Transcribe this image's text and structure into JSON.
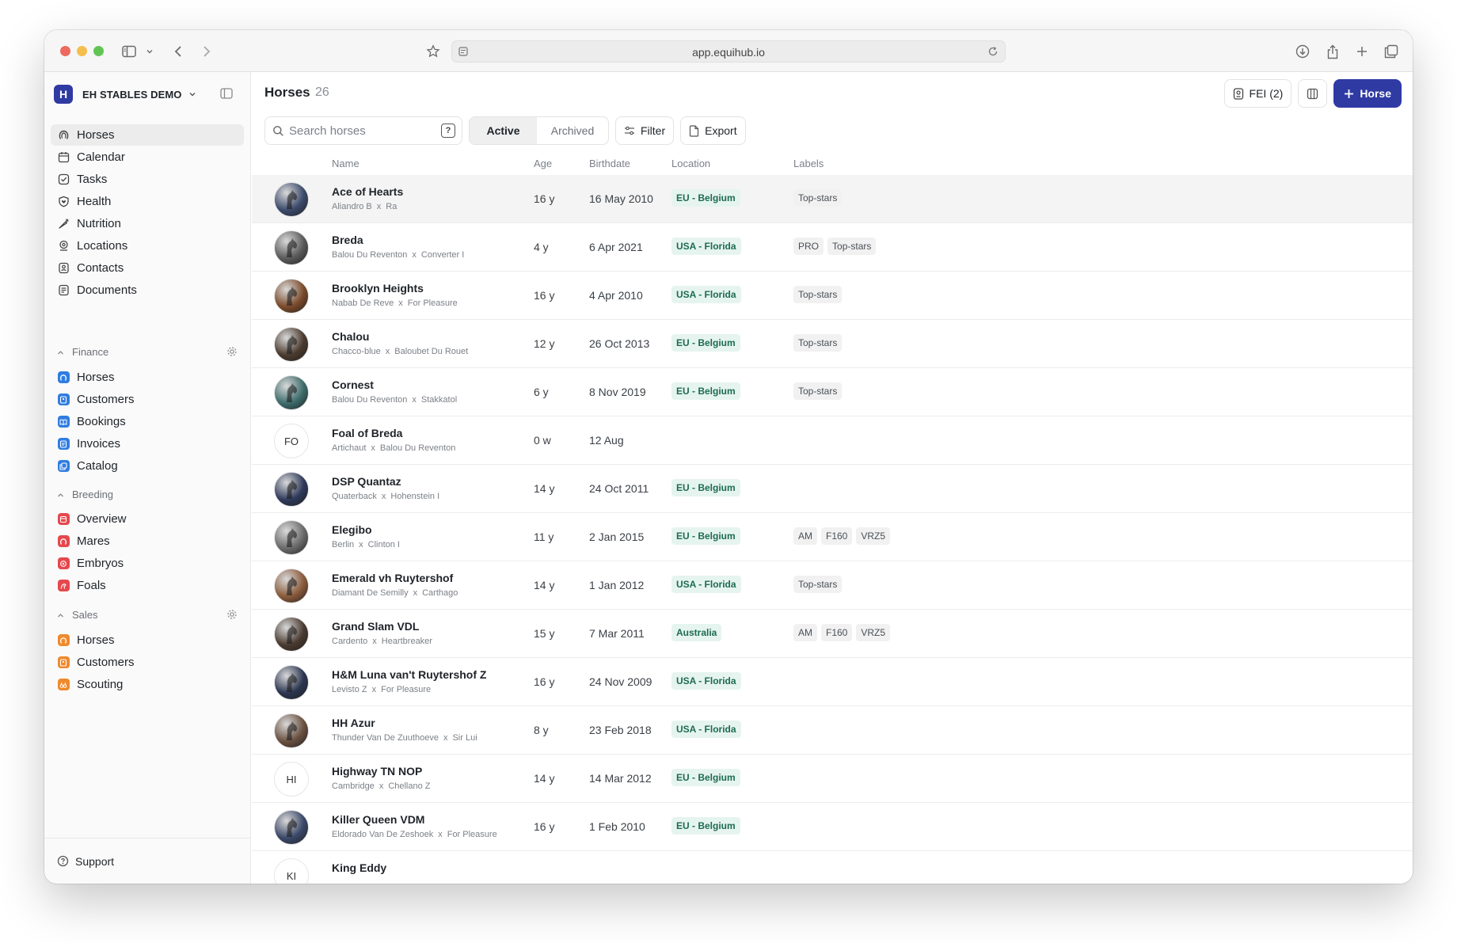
{
  "browser": {
    "url": "app.equihub.io"
  },
  "sidebar": {
    "workspace_initial": "H",
    "workspace_name": "EH STABLES DEMO",
    "main_items": [
      {
        "label": "Horses",
        "icon": "horseshoe-icon",
        "active": true
      },
      {
        "label": "Calendar",
        "icon": "calendar-icon"
      },
      {
        "label": "Tasks",
        "icon": "check-square-icon"
      },
      {
        "label": "Health",
        "icon": "heart-shield-icon"
      },
      {
        "label": "Nutrition",
        "icon": "carrot-icon"
      },
      {
        "label": "Locations",
        "icon": "map-pin-icon"
      },
      {
        "label": "Contacts",
        "icon": "contact-icon"
      },
      {
        "label": "Documents",
        "icon": "document-icon"
      }
    ],
    "sections": [
      {
        "title": "Finance",
        "color": "#2f7de1",
        "items": [
          "Horses",
          "Customers",
          "Bookings",
          "Invoices",
          "Catalog"
        ]
      },
      {
        "title": "Breeding",
        "color": "#e5484d",
        "items": [
          "Overview",
          "Mares",
          "Embryos",
          "Foals"
        ]
      },
      {
        "title": "Sales",
        "color": "#f0892b",
        "items": [
          "Horses",
          "Customers",
          "Scouting"
        ]
      }
    ],
    "support_label": "Support"
  },
  "header": {
    "title": "Horses",
    "count": "26",
    "fei_label": "FEI (2)",
    "add_label": "Horse"
  },
  "toolbar": {
    "search_placeholder": "Search horses",
    "help_glyph": "?",
    "tab_active": "Active",
    "tab_archived": "Archived",
    "filter_label": "Filter",
    "export_label": "Export"
  },
  "table": {
    "columns": {
      "name": "Name",
      "age": "Age",
      "birthdate": "Birthdate",
      "location": "Location",
      "labels": "Labels"
    },
    "rows": [
      {
        "name": "Ace of Hearts",
        "sire": "Aliandro B",
        "dam": "Ra",
        "age": "16 y",
        "birthdate": "16 May 2010",
        "location": "EU - Belgium",
        "labels": [
          "Top-stars"
        ],
        "avatar": "photo",
        "tone": "#3b4a6b"
      },
      {
        "name": "Breda",
        "sire": "Balou Du Reventon",
        "dam": "Converter I",
        "age": "4 y",
        "birthdate": "6 Apr 2021",
        "location": "USA - Florida",
        "labels": [
          "PRO",
          "Top-stars"
        ],
        "avatar": "photo",
        "tone": "#5a5a5a"
      },
      {
        "name": "Brooklyn Heights",
        "sire": "Nabab De Reve",
        "dam": "For Pleasure",
        "age": "16 y",
        "birthdate": "4 Apr 2010",
        "location": "USA - Florida",
        "labels": [
          "Top-stars"
        ],
        "avatar": "photo",
        "tone": "#7a4a2a"
      },
      {
        "name": "Chalou",
        "sire": "Chacco-blue",
        "dam": "Baloubet Du Rouet",
        "age": "12 y",
        "birthdate": "26 Oct 2013",
        "location": "EU - Belgium",
        "labels": [
          "Top-stars"
        ],
        "avatar": "photo",
        "tone": "#4b3a2e"
      },
      {
        "name": "Cornest",
        "sire": "Balou Du Reventon",
        "dam": "Stakkatol",
        "age": "6 y",
        "birthdate": "8 Nov 2019",
        "location": "EU - Belgium",
        "labels": [
          "Top-stars"
        ],
        "avatar": "photo",
        "tone": "#3d6b6b"
      },
      {
        "name": "Foal of Breda",
        "sire": "Artichaut",
        "dam": "Balou Du Reventon",
        "age": "0 w",
        "birthdate": "12 Aug",
        "location": "",
        "labels": [],
        "avatar": "initials",
        "initials": "FO"
      },
      {
        "name": "DSP Quantaz",
        "sire": "Quaterback",
        "dam": "Hohenstein I",
        "age": "14 y",
        "birthdate": "24 Oct 2011",
        "location": "EU - Belgium",
        "labels": [],
        "avatar": "photo",
        "tone": "#2e3a5a"
      },
      {
        "name": "Elegibo",
        "sire": "Berlin",
        "dam": "Clinton I",
        "age": "11 y",
        "birthdate": "2 Jan 2015",
        "location": "EU - Belgium",
        "labels": [
          "AM",
          "F160",
          "VRZ5"
        ],
        "avatar": "photo",
        "tone": "#6b6b6b"
      },
      {
        "name": "Emerald vh Ruytershof",
        "sire": "Diamant De Semilly",
        "dam": "Carthago",
        "age": "14 y",
        "birthdate": "1 Jan 2012",
        "location": "USA - Florida",
        "labels": [
          "Top-stars"
        ],
        "avatar": "photo",
        "tone": "#8a5a3a"
      },
      {
        "name": "Grand Slam VDL",
        "sire": "Cardento",
        "dam": "Heartbreaker",
        "age": "15 y",
        "birthdate": "7 Mar 2011",
        "location": "Australia",
        "labels": [
          "AM",
          "F160",
          "VRZ5"
        ],
        "avatar": "photo",
        "tone": "#4a3a30"
      },
      {
        "name": "H&M Luna van't Ruytershof Z",
        "sire": "Levisto Z",
        "dam": "For Pleasure",
        "age": "16 y",
        "birthdate": "24 Nov 2009",
        "location": "USA - Florida",
        "labels": [],
        "avatar": "photo",
        "tone": "#2a3550"
      },
      {
        "name": "HH Azur",
        "sire": "Thunder Van De Zuuthoeve",
        "dam": "Sir Lui",
        "age": "8 y",
        "birthdate": "23 Feb 2018",
        "location": "USA - Florida",
        "labels": [],
        "avatar": "photo",
        "tone": "#6a5040"
      },
      {
        "name": "Highway TN NOP",
        "sire": "Cambridge",
        "dam": "Chellano Z",
        "age": "14 y",
        "birthdate": "14 Mar 2012",
        "location": "EU - Belgium",
        "labels": [],
        "avatar": "initials",
        "initials": "HI"
      },
      {
        "name": "Killer Queen VDM",
        "sire": "Eldorado Van De Zeshoek",
        "dam": "For Pleasure",
        "age": "16 y",
        "birthdate": "1 Feb 2010",
        "location": "EU - Belgium",
        "labels": [],
        "avatar": "photo",
        "tone": "#3a4868"
      },
      {
        "name": "King Eddy",
        "sire": "",
        "dam": "",
        "age": "",
        "birthdate": "",
        "location": "",
        "labels": [],
        "avatar": "initials",
        "initials": "KI"
      }
    ]
  }
}
